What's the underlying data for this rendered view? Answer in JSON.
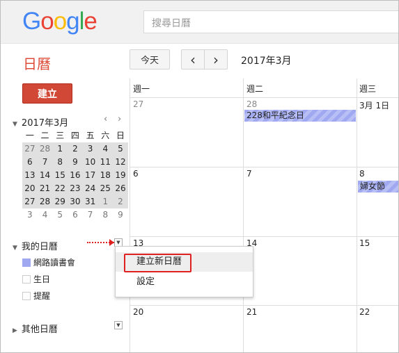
{
  "header": {
    "logo_letters": [
      {
        "ch": "G",
        "color": "#4285f4"
      },
      {
        "ch": "o",
        "color": "#ea4335"
      },
      {
        "ch": "o",
        "color": "#fbbc05"
      },
      {
        "ch": "g",
        "color": "#4285f4"
      },
      {
        "ch": "l",
        "color": "#34a853"
      },
      {
        "ch": "e",
        "color": "#ea4335"
      }
    ],
    "search_placeholder": "搜尋日曆"
  },
  "toolbar": {
    "app_title": "日曆",
    "today_label": "今天",
    "prev_label": "‹",
    "next_label": "›",
    "date_range": "2017年3月"
  },
  "sidebar": {
    "create_label": "建立",
    "mini_calendar": {
      "title": "2017年3月",
      "prev": "‹",
      "next": "›",
      "weekdays": [
        "一",
        "二",
        "三",
        "四",
        "五",
        "六",
        "日"
      ],
      "weeks": [
        [
          "27",
          "28",
          "1",
          "2",
          "3",
          "4",
          "5"
        ],
        [
          "6",
          "7",
          "8",
          "9",
          "10",
          "11",
          "12"
        ],
        [
          "13",
          "14",
          "15",
          "16",
          "17",
          "18",
          "19"
        ],
        [
          "20",
          "21",
          "22",
          "23",
          "24",
          "25",
          "26"
        ],
        [
          "27",
          "28",
          "29",
          "30",
          "31",
          "1",
          "2"
        ],
        [
          "3",
          "4",
          "5",
          "6",
          "7",
          "8",
          "9"
        ]
      ]
    },
    "my_calendars": {
      "title": "我的日曆",
      "items": [
        {
          "label": "網路讀書會",
          "color": "#9fa8f0"
        },
        {
          "label": "生日",
          "color": "#ffffff"
        },
        {
          "label": "提醒",
          "color": "#ffffff"
        }
      ]
    },
    "other_calendars": {
      "title": "其他日曆"
    }
  },
  "grid": {
    "day_headers": [
      "週一",
      "週二",
      "週三"
    ],
    "weeks": [
      {
        "dates": [
          "27",
          "28",
          "3月 1日"
        ]
      },
      {
        "dates": [
          "6",
          "7",
          "8"
        ]
      },
      {
        "dates": [
          "13",
          "14",
          "15"
        ]
      },
      {
        "dates": [
          "20",
          "21",
          "22"
        ]
      }
    ],
    "events": [
      {
        "label": "228和平紀念日",
        "color": "#9fa8f0"
      },
      {
        "label": "婦女節",
        "color": "#9fa8f0"
      }
    ]
  },
  "menu": {
    "items": [
      "建立新日曆",
      "設定"
    ]
  }
}
